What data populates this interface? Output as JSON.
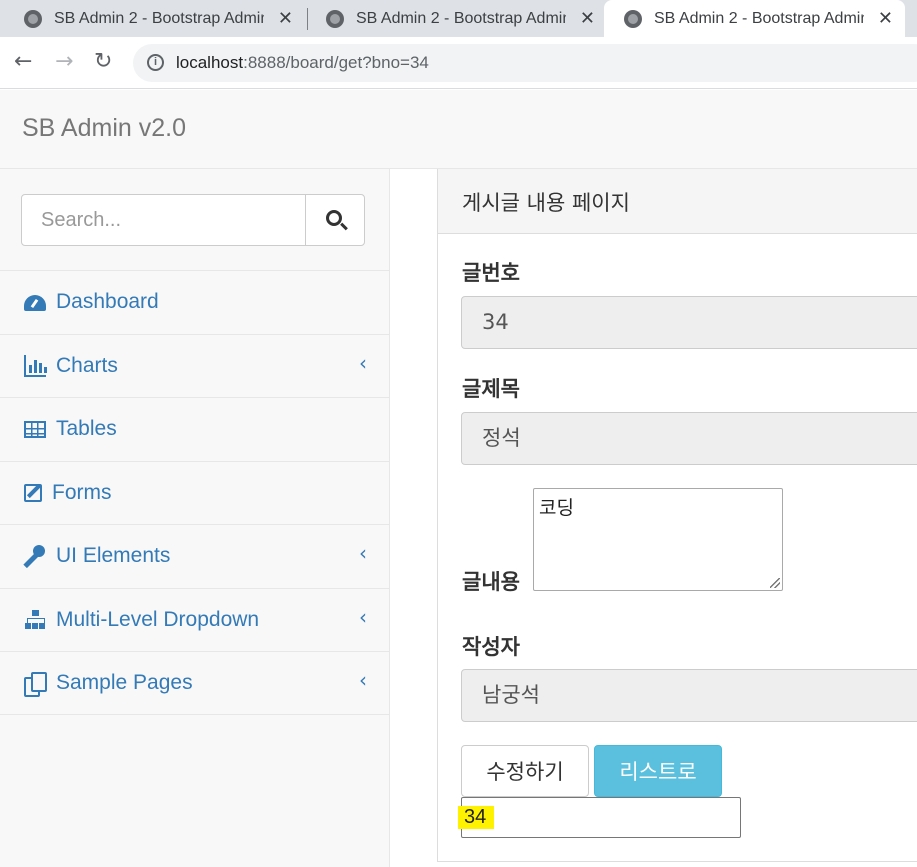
{
  "browser": {
    "tabs": [
      {
        "title": "SB Admin 2 - Bootstrap Admin",
        "close": "✕"
      },
      {
        "title": "SB Admin 2 - Bootstrap Admin",
        "close": "✕"
      },
      {
        "title": "SB Admin 2 - Bootstrap Admin",
        "close": "✕"
      }
    ],
    "active_tab": 2,
    "url_host": "localhost",
    "url_rest": ":8888/board/get?bno=34",
    "back": "←",
    "forward": "→",
    "reload": "↻"
  },
  "header": {
    "brand": "SB Admin v2.0"
  },
  "sidebar": {
    "search_placeholder": "Search...",
    "items": [
      {
        "label": "Dashboard",
        "icon": "dashboard-icon",
        "has_caret": false
      },
      {
        "label": "Charts",
        "icon": "bar-chart-icon",
        "has_caret": true
      },
      {
        "label": "Tables",
        "icon": "table-icon",
        "has_caret": false
      },
      {
        "label": "Forms",
        "icon": "edit-icon",
        "has_caret": false
      },
      {
        "label": "UI Elements",
        "icon": "wrench-icon",
        "has_caret": true
      },
      {
        "label": "Multi-Level Dropdown",
        "icon": "sitemap-icon",
        "has_caret": true
      },
      {
        "label": "Sample Pages",
        "icon": "files-icon",
        "has_caret": true
      }
    ],
    "caret": "‹"
  },
  "panel": {
    "heading": "게시글 내용 페이지",
    "bno_label": "글번호",
    "bno_value": "34",
    "title_label": "글제목",
    "title_value": "정석",
    "content_label": "글내용",
    "content_value": "코딩",
    "writer_label": "작성자",
    "writer_value": "남궁석",
    "modify_button": "수정하기",
    "list_button": "리스트로",
    "hidden_bno": "34"
  },
  "colors": {
    "link": "#337ab7",
    "info_button": "#5bc0de",
    "highlight": "#fff200"
  }
}
